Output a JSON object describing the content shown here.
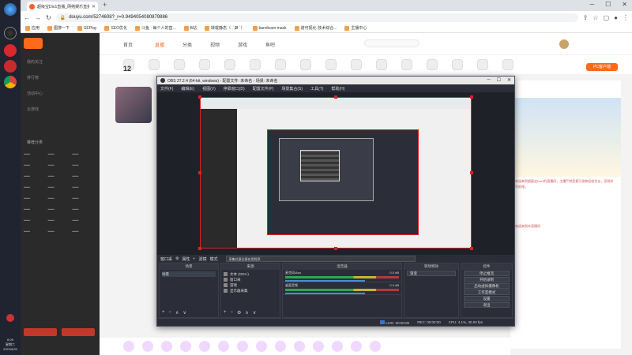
{
  "browser": {
    "tab_title": "超级宝Dio1直播_网络娱乐直播_斗鱼",
    "url": "douyu.com/5274608?_r=0.9494054080879886",
    "bookmarks": [
      "应用",
      "图搜一下",
      "SEPlay",
      "SEO优化",
      "斗鱼 · 每个人的直...",
      "B站",
      "转载静态（ ·`Ꮺ·`）",
      "bandicam mask",
      "谱可视化·技术综合...",
      "主播中心"
    ]
  },
  "taskbar": {
    "time": "6:09",
    "day": "星期六",
    "date": "2022/8/20"
  },
  "douyu": {
    "sidebar_items": [
      "我的关注",
      "排行榜",
      "活动中心",
      "云游戏"
    ],
    "sidebar_section": "推荐分类",
    "nav": [
      "首页",
      "直播",
      "分类",
      "视频",
      "游戏",
      "鱼吧"
    ],
    "big_number": "12",
    "pc_button": "PC客户端",
    "right_text": "欢迎来到超级宝Dio1的直播间，主播严禁恶意引流和低俗言论，否则封号处理。",
    "welcome": "欢迎来到本直播间"
  },
  "obs": {
    "title": "OBS 27.2.4 (64-bit, windows) - 配置文件: 未命名 - 场景: 未命名",
    "menu": [
      "文件(F)",
      "编辑(E)",
      "视图(V)",
      "停靠窗口(D)",
      "配置文件(P)",
      "场景集合(S)",
      "工具(T)",
      "帮助(H)"
    ],
    "status_row": {
      "source_label": "窗口采",
      "properties": "属性",
      "filters": "滤镜",
      "mode_label": "模式",
      "mode_value": "采集任意全屏应用程序"
    },
    "docks": {
      "scenes": {
        "header": "场景",
        "items": [
          "场景"
        ]
      },
      "sources": {
        "header": "来源",
        "items": [
          "文本 (GDI+)",
          "窗口采",
          "游戏",
          "显示器采集"
        ]
      },
      "mixer": {
        "header": "混音器",
        "channels": [
          {
            "name": "麦克风/Aux",
            "db": "0.0 dB"
          },
          {
            "name": "桌面音频",
            "db": "0.0 dB"
          }
        ]
      },
      "transitions": {
        "header": "转场特效",
        "value": "渐变"
      },
      "controls": {
        "header": "控件",
        "buttons": [
          "停止推流",
          "开始录制",
          "启动虚拟摄像机",
          "工作室模式",
          "设置",
          "退出"
        ]
      }
    },
    "footer": {
      "live": "LIVE: 00:00:00",
      "rec": "REC: 00:00:00",
      "cpu": "CPU: 4.1%, 30.00 fps"
    }
  }
}
